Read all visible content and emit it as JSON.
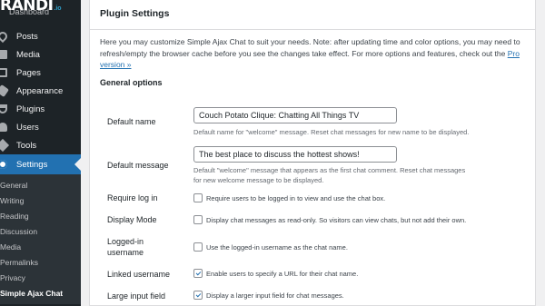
{
  "brand": {
    "main": "RANDI",
    "sub": ".io"
  },
  "sidebar": {
    "top_item": "Dashboard",
    "items": [
      {
        "label": "Posts",
        "icon": "pin-icon"
      },
      {
        "label": "Media",
        "icon": "media-icon"
      },
      {
        "label": "Pages",
        "icon": "page-icon"
      },
      {
        "label": "Appearance",
        "icon": "brush-icon"
      },
      {
        "label": "Plugins",
        "icon": "plugin-icon"
      },
      {
        "label": "Users",
        "icon": "users-icon"
      },
      {
        "label": "Tools",
        "icon": "tools-icon"
      },
      {
        "label": "Settings",
        "icon": "settings-icon",
        "active": true
      }
    ],
    "submenu": [
      "General",
      "Writing",
      "Reading",
      "Discussion",
      "Media",
      "Permalinks",
      "Privacy",
      "Simple Ajax Chat"
    ],
    "current_submenu": "Simple Ajax Chat"
  },
  "panel": {
    "title": "Plugin Settings",
    "intro_text": "Here you may customize Simple Ajax Chat to suit your needs. Note: after updating time and color options, you may need to refresh/empty the browser cache before you see the changes take effect. For more options and features, check out the ",
    "intro_link": "Pro version »",
    "section_title": "General options"
  },
  "fields": {
    "default_name": {
      "label": "Default name",
      "value": "Couch Potato Clique: Chatting All Things TV",
      "desc": "Default name for \"welcome\" message. Reset chat messages for new name to be displayed."
    },
    "default_message": {
      "label": "Default message",
      "value": "The best place to discuss the hottest shows!",
      "desc": "Default \"welcome\" message that appears as the first chat comment. Reset chat messages for new welcome message to be displayed."
    },
    "require_login": {
      "label": "Require log in",
      "checked": false,
      "desc": "Require users to be logged in to view and use the chat box."
    },
    "display_mode": {
      "label": "Display Mode",
      "checked": false,
      "desc": "Display chat messages as read-only. So visitors can view chats, but not add their own."
    },
    "logged_in_username": {
      "label": "Logged-in username",
      "checked": false,
      "desc": "Use the logged-in username as the chat name."
    },
    "linked_username": {
      "label": "Linked username",
      "checked": true,
      "desc": "Enable users to specify a URL for their chat name."
    },
    "large_input": {
      "label": "Large input field",
      "checked": true,
      "desc": "Display a larger input field for chat messages."
    }
  },
  "colors": {
    "sidebar_bg": "#1d2327",
    "accent": "#2271b1",
    "page_bg": "#f0f0f1"
  }
}
